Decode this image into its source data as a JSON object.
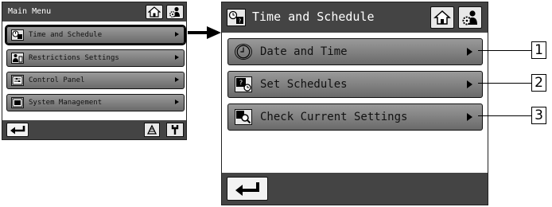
{
  "main_menu": {
    "title": "Main Menu",
    "items": [
      {
        "label": "Time and Schedule"
      },
      {
        "label": "Restrictions Settings"
      },
      {
        "label": "Control Panel"
      },
      {
        "label": "System Management"
      }
    ]
  },
  "time_schedule": {
    "title": "Time and Schedule",
    "items": [
      {
        "label": "Date and Time",
        "callout": "1"
      },
      {
        "label": "Set Schedules",
        "callout": "2"
      },
      {
        "label": "Check Current Settings",
        "callout": "3"
      }
    ]
  },
  "icons": {
    "home": "home-icon",
    "settings": "person-gear-icon",
    "back": "return-arrow-icon",
    "maintenance": "maintenance-icon",
    "wrench": "wrench-icon",
    "clock": "clock-icon",
    "schedule": "schedule-icon",
    "check": "magnifier-icon"
  },
  "colors": {
    "titlebar": "#444444",
    "menu_button": "#8a8a8a"
  }
}
